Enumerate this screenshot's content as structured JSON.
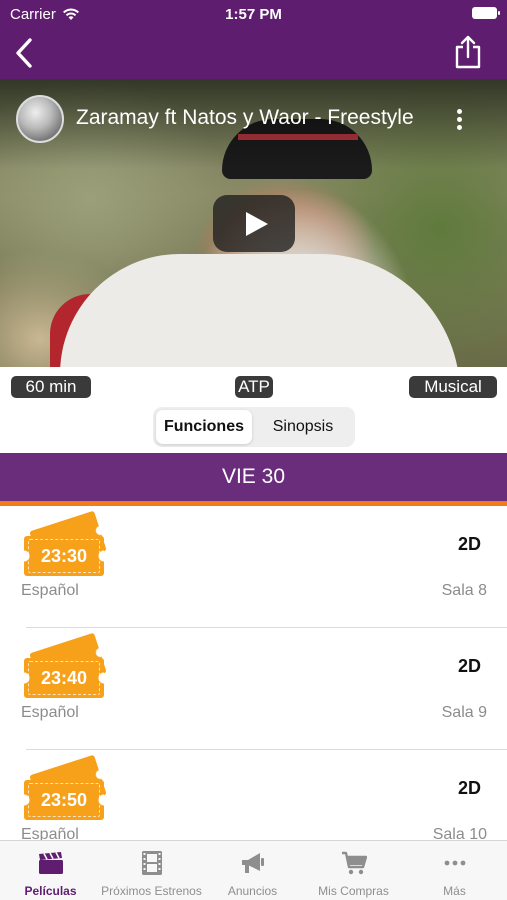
{
  "status_bar": {
    "carrier": "Carrier",
    "time": "1:57 PM"
  },
  "nav": {
    "back_icon": "chevron-left-icon",
    "share_icon": "share-icon"
  },
  "video": {
    "title": "Zaramay ft Natos y Waor - Freestyle",
    "play_icon": "play-icon",
    "menu_icon": "more-vertical-icon"
  },
  "tags": {
    "duration": "60 min",
    "rating": "ATP",
    "genre": "Musical"
  },
  "segmented": {
    "functions": "Funciones",
    "synopsis": "Sinopsis",
    "selected": "Funciones"
  },
  "day": {
    "label": "VIE 30"
  },
  "colors": {
    "primary": "#5f1d6f",
    "day_header": "#6a2d7b",
    "accent": "#f07d1a",
    "ticket": "#f7a01a"
  },
  "showtimes": [
    {
      "time": "23:30",
      "format": "2D",
      "language": "Español",
      "room": "Sala 8"
    },
    {
      "time": "23:40",
      "format": "2D",
      "language": "Español",
      "room": "Sala 9"
    },
    {
      "time": "23:50",
      "format": "2D",
      "language": "Español",
      "room": "Sala 10"
    }
  ],
  "tabbar": [
    {
      "label": "Películas",
      "icon": "clapperboard-icon",
      "active": true
    },
    {
      "label": "Próximos Estrenos",
      "icon": "film-strip-icon",
      "active": false
    },
    {
      "label": "Anuncios",
      "icon": "megaphone-icon",
      "active": false
    },
    {
      "label": "Mis Compras",
      "icon": "cart-icon",
      "active": false
    },
    {
      "label": "Más",
      "icon": "more-horizontal-icon",
      "active": false
    }
  ]
}
